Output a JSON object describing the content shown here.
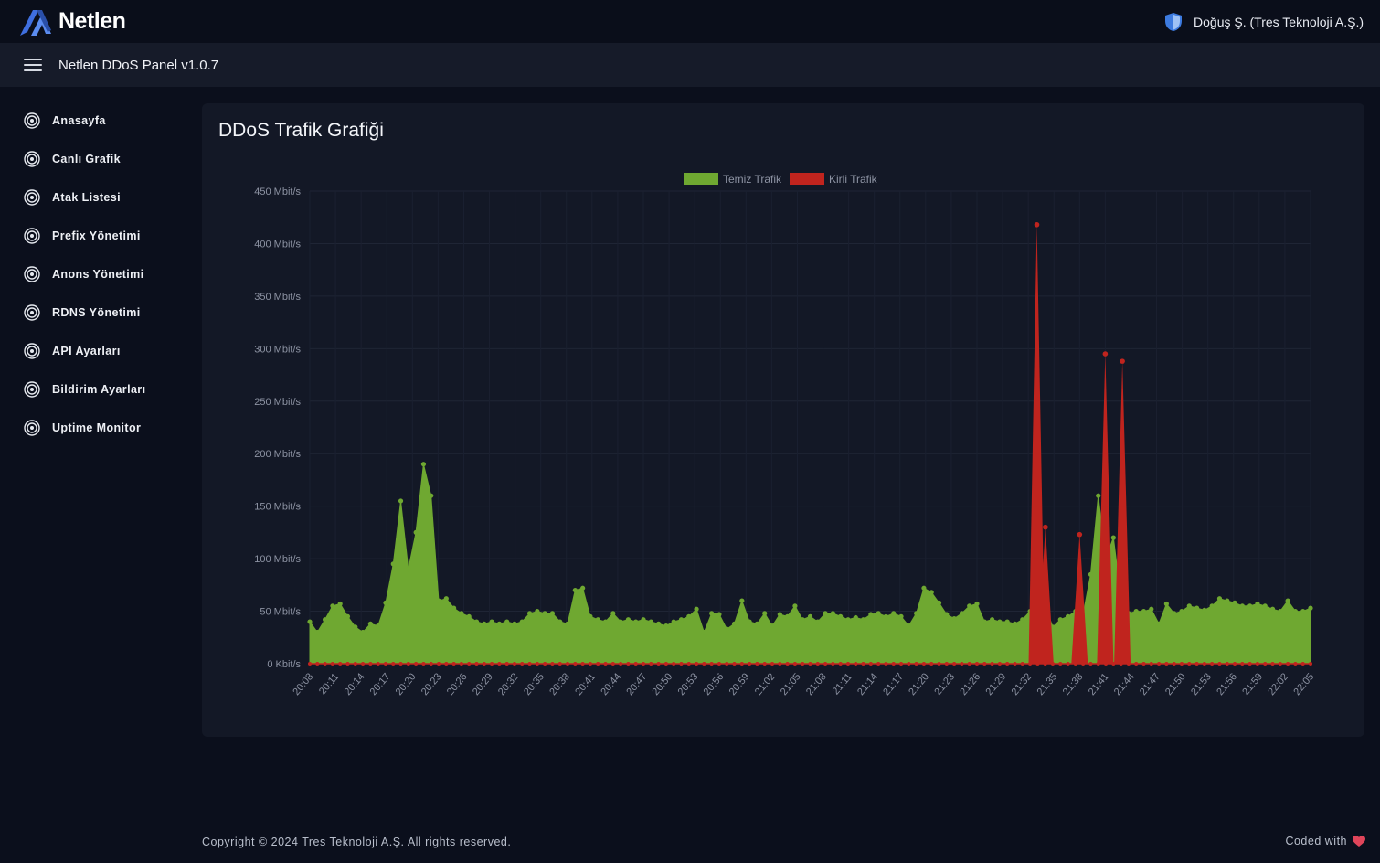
{
  "header": {
    "brand_name": "Netlen",
    "user_name": "Doğuş Ş. (Tres Teknoloji A.Ş.)"
  },
  "subheader": {
    "panel_title": "Netlen DDoS Panel v1.0.7"
  },
  "sidebar": {
    "items": [
      {
        "label": "Anasayfa",
        "icon": "target-icon"
      },
      {
        "label": "Canlı Grafik",
        "icon": "target-icon"
      },
      {
        "label": "Atak Listesi",
        "icon": "target-icon"
      },
      {
        "label": "Prefix Yönetimi",
        "icon": "target-icon"
      },
      {
        "label": "Anons Yönetimi",
        "icon": "target-icon"
      },
      {
        "label": "RDNS Yönetimi",
        "icon": "target-icon"
      },
      {
        "label": "API Ayarları",
        "icon": "target-icon"
      },
      {
        "label": "Bildirim Ayarları",
        "icon": "target-icon"
      },
      {
        "label": "Uptime Monitor",
        "icon": "target-icon"
      }
    ]
  },
  "footer": {
    "copyright": "Copyright © 2024 Tres Teknoloji A.Ş. All rights reserved.",
    "coded_with": "Coded with"
  },
  "colors": {
    "clean": "#6fa831",
    "dirty": "#c0241e",
    "background": "#0b0f1c",
    "card": "#131826"
  },
  "chart_data": {
    "type": "area",
    "title": "DDoS Trafik Grafiği",
    "legend_position": "top-center",
    "grid": true,
    "ylim": [
      0,
      450
    ],
    "y_ticks": [
      0,
      50,
      100,
      150,
      200,
      250,
      300,
      350,
      400,
      450
    ],
    "y_tick_labels": [
      "0 Kbit/s",
      "50 Mbit/s",
      "100 Mbit/s",
      "150 Mbit/s",
      "200 Mbit/s",
      "250 Mbit/s",
      "300 Mbit/s",
      "350 Mbit/s",
      "400 Mbit/s",
      "450 Mbit/s"
    ],
    "x_tick_labels": [
      "20:08",
      "20:11",
      "20:14",
      "20:17",
      "20:20",
      "20:23",
      "20:26",
      "20:29",
      "20:32",
      "20:35",
      "20:38",
      "20:41",
      "20:44",
      "20:47",
      "20:50",
      "20:53",
      "20:56",
      "20:59",
      "21:02",
      "21:05",
      "21:08",
      "21:11",
      "21:14",
      "21:17",
      "21:20",
      "21:23",
      "21:26",
      "21:29",
      "21:32",
      "21:35",
      "21:38",
      "21:41",
      "21:44",
      "21:47",
      "21:50",
      "21:53",
      "21:56",
      "21:59",
      "22:02",
      "22:05"
    ],
    "x_start": "20:08",
    "x_end": "22:05",
    "series": [
      {
        "name": "Temiz Trafik",
        "color": "#6fa831",
        "values": [
          40,
          30,
          42,
          55,
          57,
          45,
          35,
          30,
          38,
          36,
          58,
          95,
          155,
          90,
          125,
          190,
          160,
          60,
          62,
          53,
          48,
          45,
          40,
          38,
          40,
          38,
          40,
          38,
          40,
          48,
          50,
          48,
          48,
          40,
          38,
          70,
          72,
          45,
          42,
          40,
          48,
          40,
          42,
          40,
          42,
          40,
          38,
          36,
          40,
          42,
          45,
          52,
          30,
          48,
          47,
          33,
          38,
          60,
          40,
          38,
          48,
          36,
          47,
          45,
          55,
          42,
          45,
          40,
          48,
          48,
          45,
          42,
          44,
          42,
          47,
          48,
          45,
          48,
          45,
          36,
          48,
          72,
          68,
          58,
          47,
          43,
          48,
          55,
          57,
          40,
          42,
          40,
          40,
          38,
          42,
          50,
          68,
          55,
          35,
          42,
          45,
          50,
          47,
          85,
          160,
          100,
          120,
          62,
          48,
          50,
          50,
          52,
          38,
          57,
          48,
          50,
          55,
          53,
          51,
          55,
          62,
          60,
          58,
          55,
          55,
          57,
          55,
          52,
          50,
          60,
          50,
          50,
          53
        ]
      },
      {
        "name": "Kirli Trafik",
        "color": "#c0241e",
        "values": [
          0,
          0,
          0,
          0,
          0,
          0,
          0,
          0,
          0,
          0,
          0,
          0,
          0,
          0,
          0,
          0,
          0,
          0,
          0,
          0,
          0,
          0,
          0,
          0,
          0,
          0,
          0,
          0,
          0,
          0,
          0,
          0,
          0,
          0,
          0,
          0,
          0,
          0,
          0,
          0,
          0,
          0,
          0,
          0,
          0,
          0,
          0,
          0,
          0,
          0,
          0,
          0,
          0,
          0,
          0,
          0,
          0,
          0,
          0,
          0,
          0,
          0,
          0,
          0,
          0,
          0,
          0,
          0,
          0,
          0,
          0,
          0,
          0,
          0,
          0,
          0,
          0,
          0,
          0,
          0,
          0,
          0,
          0,
          0,
          0,
          0,
          0,
          0,
          0,
          0,
          0,
          0,
          0,
          0,
          0,
          0,
          0,
          0,
          0,
          0,
          0,
          0,
          0,
          0,
          0,
          0,
          0,
          0,
          0,
          0,
          0,
          0,
          0,
          0,
          0,
          0,
          0,
          0,
          0,
          0,
          0,
          0,
          0,
          0,
          0,
          0,
          0,
          0,
          0,
          0,
          0,
          0,
          0
        ]
      }
    ],
    "dirty_peaks": [
      {
        "time": "21:33",
        "value": 418
      },
      {
        "time": "21:34",
        "value": 130
      },
      {
        "time": "21:38",
        "value": 123
      },
      {
        "time": "21:41",
        "value": 295
      },
      {
        "time": "21:43",
        "value": 288
      }
    ]
  }
}
